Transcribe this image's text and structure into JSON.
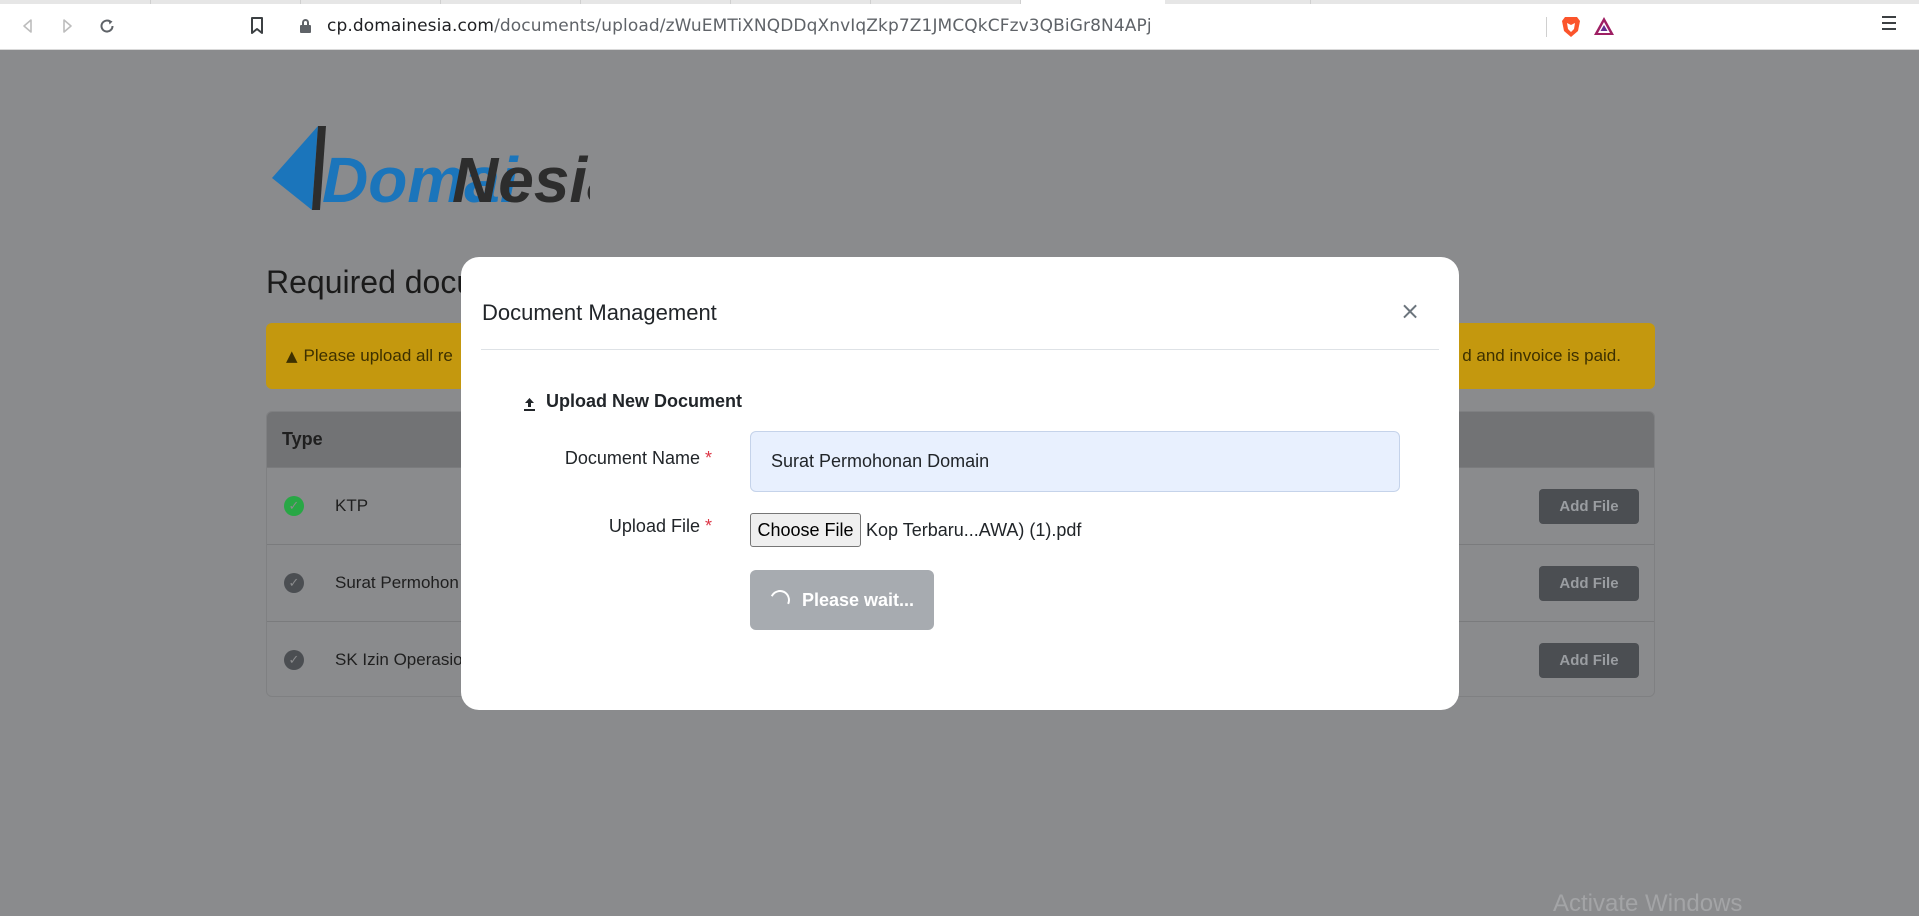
{
  "browser": {
    "url_host": "cp.domainesia.com",
    "url_path": "/documents/upload/zWuEMTiXNQDDqXnvIqZkp7Z1JMCQkCFzv3QBiGr8N4APj"
  },
  "page": {
    "logo_text_1": "Domai",
    "logo_text_2": "Nesia",
    "title": "Required docu",
    "alert_left": "Please upload all re",
    "alert_right": "d and invoice is paid.",
    "table_header": "Type",
    "rows": [
      {
        "name": "KTP",
        "status_color": "#28a745",
        "action": "Add File"
      },
      {
        "name": "Surat Permohon",
        "status_color": "#4b4e52",
        "action": "Add File"
      },
      {
        "name": "SK Izin Operasio",
        "status_color": "#4b4e52",
        "action": "Add File"
      }
    ],
    "watermark": "Activate Windows"
  },
  "modal": {
    "title": "Document Management",
    "close_symbol": "×",
    "section_title": "Upload New Document",
    "document_name_label": "Document Name",
    "upload_file_label": "Upload File",
    "required_mark": "*",
    "document_name_value": "Surat Permohonan Domain",
    "choose_file_label": "Choose File",
    "file_name": "Kop Terbaru...AWA) (1).pdf",
    "submit_label": "Please wait..."
  },
  "colors": {
    "overlay_background": "#8a8b8d",
    "alert": "#c4980e",
    "input_background": "#e8f0fe",
    "required": "#dc3545",
    "disabled_button": "#a7abb0"
  }
}
